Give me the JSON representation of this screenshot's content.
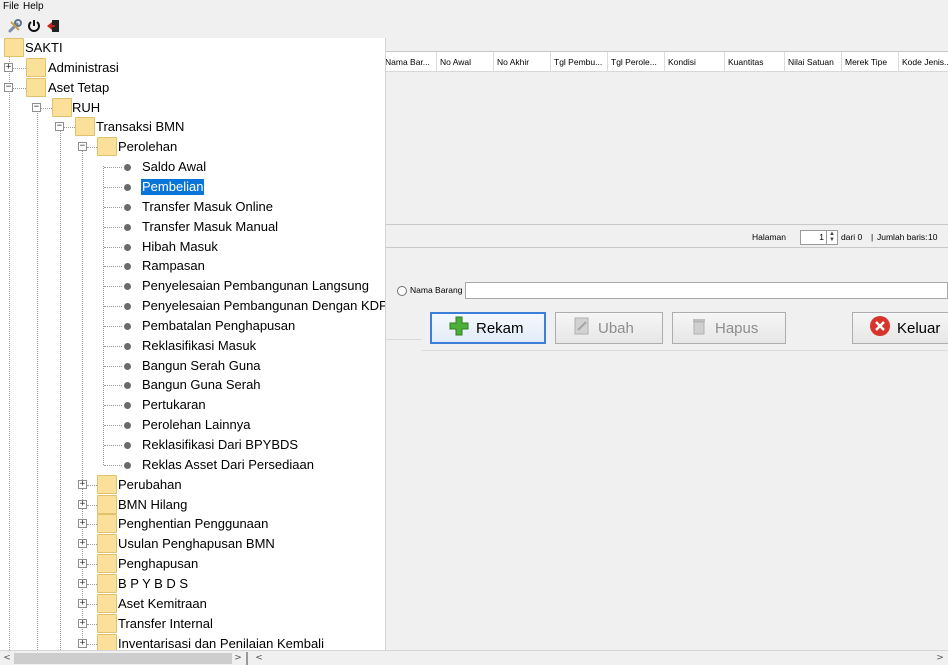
{
  "menu": {
    "file": "File",
    "help": "Help"
  },
  "toolbar_icons": [
    "wrench-icon",
    "power-icon",
    "exit-icon"
  ],
  "grid": {
    "columns": [
      "Nama Bar...",
      "No Awal",
      "No Akhir",
      "Tgl Pembu...",
      "Tgl Perole...",
      "Kondisi",
      "Kuantitas",
      "Nilai Satuan",
      "Merek Tipe",
      "Kode Jenis..."
    ]
  },
  "pager": {
    "halaman": "Halaman",
    "page": "1",
    "dari": "dari 0",
    "sep": "|",
    "jumlah": "Jumlah baris:",
    "count": "10"
  },
  "search": {
    "radio_label": "Nama Barang",
    "value": ""
  },
  "buttons": {
    "rekam": "Rekam",
    "ubah": "Ubah",
    "hapus": "Hapus",
    "keluar": "Keluar"
  },
  "tree": {
    "root": "SAKTI",
    "administrasi": "Administrasi",
    "aset_tetap": "Aset Tetap",
    "ruh": "RUH",
    "transaksi": "Transaksi BMN",
    "perolehan": "Perolehan",
    "perolehan_items": [
      "Saldo Awal",
      "Pembelian",
      "Transfer Masuk Online",
      "Transfer Masuk Manual",
      "Hibah Masuk",
      "Rampasan",
      "Penyelesaian Pembangunan Langsung",
      "Penyelesaian Pembangunan Dengan KDP",
      "Pembatalan Penghapusan",
      "Reklasifikasi Masuk",
      "Bangun Serah Guna",
      "Bangun Guna Serah",
      "Pertukaran",
      "Perolehan Lainnya",
      "Reklasifikasi Dari BPYBDS",
      "Reklas Asset Dari Persediaan"
    ],
    "selected_index": 1,
    "transaksi_folders": [
      "Perubahan",
      "BMN Hilang",
      "Penghentian Penggunaan",
      "Usulan Penghapusan BMN",
      "Penghapusan",
      "B P Y B D S",
      "Aset Kemitraan",
      "Transfer Internal",
      "Inventarisasi dan Penilaian Kembali"
    ]
  },
  "colors": {
    "selection": "#0a75d8",
    "folder": "#fbe09a",
    "accent_border": "#3c7fd6",
    "plus_green": "#4caf3a",
    "exit_red": "#d9342b"
  }
}
